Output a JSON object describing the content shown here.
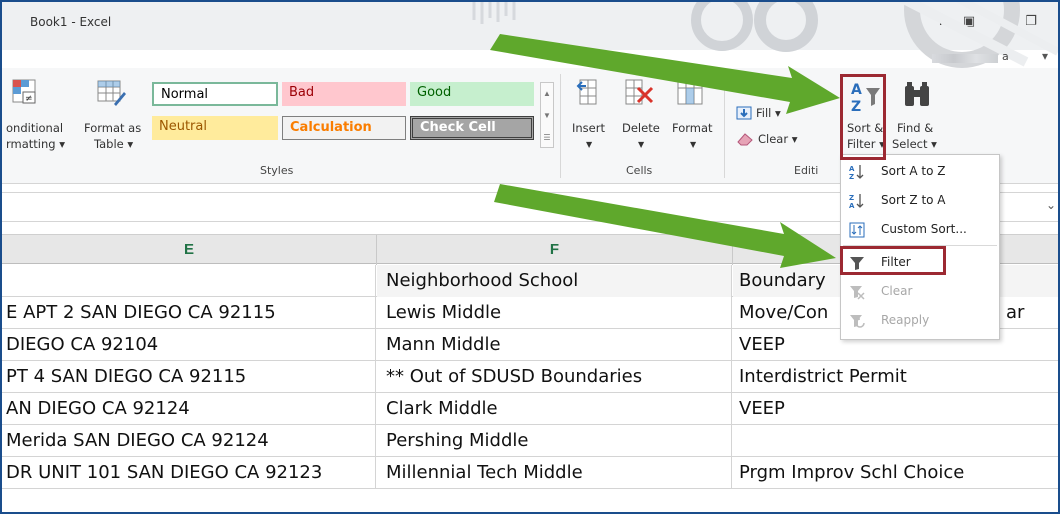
{
  "window": {
    "title": "Book1 - Excel",
    "help": "?",
    "ribbon_display": "▣",
    "minimize": "—",
    "restore": "❐",
    "account_initial": "a",
    "account_chevron": "▾"
  },
  "ribbon": {
    "conditional_formatting": [
      "onditional",
      "rmatting ▾"
    ],
    "format_as_table": [
      "Format as",
      "Table ▾"
    ],
    "styles": {
      "normal": "Normal",
      "bad": "Bad",
      "good": "Good",
      "neutral": "Neutral",
      "calculation": "Calculation",
      "check_cell": "Check Cell",
      "group_label": "Styles"
    },
    "cells": {
      "insert": "Insert",
      "delete": "Delete",
      "format": "Format",
      "group_label": "Cells"
    },
    "editing": {
      "fill": "Fill ▾",
      "clear": "Clear ▾",
      "sort_filter": [
        "Sort &",
        "Filter ▾"
      ],
      "find_select": [
        "Find &",
        "Select ▾"
      ],
      "group_label": "Editi"
    }
  },
  "sort_filter_menu": {
    "items": [
      {
        "label": "Sort A to Z",
        "enabled": true,
        "icon": "sort-ascending-icon"
      },
      {
        "label": "Sort Z to A",
        "enabled": true,
        "icon": "sort-descending-icon"
      },
      {
        "label": "Custom Sort...",
        "enabled": true,
        "icon": "custom-sort-icon"
      },
      {
        "label": "Filter",
        "enabled": true,
        "highlighted": true,
        "icon": "filter-funnel-icon"
      },
      {
        "label": "Clear",
        "enabled": false,
        "icon": "clear-filter-icon"
      },
      {
        "label": "Reapply",
        "enabled": false,
        "icon": "reapply-filter-icon"
      }
    ]
  },
  "sheet": {
    "columns": [
      "E",
      "F"
    ],
    "rows": [
      {
        "e": "",
        "f": "Neighborhood School",
        "g": "Boundary"
      },
      {
        "e": "E APT 2 SAN DIEGO CA 92115",
        "f": "Lewis Middle",
        "g": "Move/Con",
        "g_tail": "ar"
      },
      {
        "e": "DIEGO CA 92104",
        "f": "Mann Middle",
        "g": "VEEP"
      },
      {
        "e": "PT 4 SAN DIEGO CA 92115",
        "f": "** Out of SDUSD Boundaries",
        "g": "Interdistrict Permit"
      },
      {
        "e": "AN DIEGO CA 92124",
        "f": "Clark Middle",
        "g": "VEEP"
      },
      {
        "e": "Merida SAN DIEGO CA 92124",
        "f": "Pershing Middle",
        "g": ""
      },
      {
        "e": "DR UNIT 101 SAN DIEGO CA 92123",
        "f": "Millennial Tech Middle",
        "g": "Prgm Improv Schl Choice"
      }
    ]
  },
  "colors": {
    "excel_green": "#217346",
    "annotation_arrow": "#5fa82c",
    "highlight_box": "#9c2932",
    "style_bad_bg": "#ffc7ce",
    "style_good_bg": "#c6efce",
    "style_neutral_bg": "#ffeb9c"
  }
}
